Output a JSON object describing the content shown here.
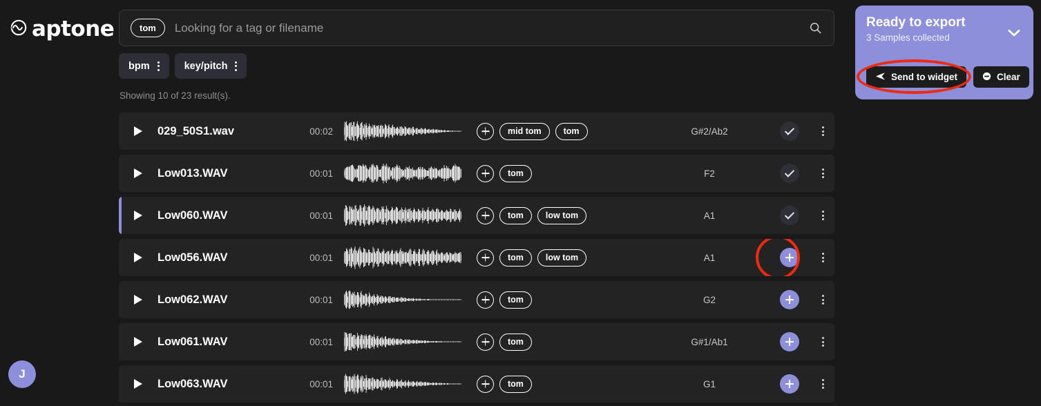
{
  "app": {
    "brand": "aptone",
    "logo_icon": "wave-circle-logo-icon",
    "avatar_initial": "J"
  },
  "search": {
    "chip_label": "tom",
    "placeholder": "Looking for a tag or filename",
    "value": "",
    "search_icon": "search-icon"
  },
  "filters": [
    {
      "label": "bpm",
      "menu_icon": "kebab-menu-icon"
    },
    {
      "label": "key/pitch",
      "menu_icon": "kebab-menu-icon"
    }
  ],
  "results_summary": "Showing 10 of 23 result(s).",
  "colors": {
    "accent_purple": "#8D8FDB",
    "page_bg": "#191919",
    "row_bg": "#232323",
    "annotation_red": "#F02A10",
    "chip_bg": "#2E2E36"
  },
  "rows": [
    {
      "filename": "029_50S1.wav",
      "duration": "00:02",
      "tags": [
        "mid tom",
        "tom"
      ],
      "key": "G#2/Ab2",
      "action_state": "added",
      "action_icon": "check-icon",
      "selected": false,
      "waveform": "decay-long"
    },
    {
      "filename": "Low013.WAV",
      "duration": "00:01",
      "tags": [
        "tom"
      ],
      "key": "F2",
      "action_state": "added",
      "action_icon": "check-icon",
      "selected": false,
      "waveform": "sustained-even"
    },
    {
      "filename": "Low060.WAV",
      "duration": "00:01",
      "tags": [
        "tom",
        "low tom"
      ],
      "key": "A1",
      "action_state": "added",
      "action_icon": "check-icon",
      "selected": true,
      "waveform": "dense-sustain"
    },
    {
      "filename": "Low056.WAV",
      "duration": "00:01",
      "tags": [
        "tom",
        "low tom"
      ],
      "key": "A1",
      "action_state": "addable",
      "action_icon": "plus-icon",
      "selected": false,
      "waveform": "dense-sustain",
      "annotated": true
    },
    {
      "filename": "Low062.WAV",
      "duration": "00:01",
      "tags": [
        "tom"
      ],
      "key": "G2",
      "action_state": "addable",
      "action_icon": "plus-icon",
      "selected": false,
      "waveform": "decay-fast"
    },
    {
      "filename": "Low061.WAV",
      "duration": "00:01",
      "tags": [
        "tom"
      ],
      "key": "G#1/Ab1",
      "action_state": "addable",
      "action_icon": "plus-icon",
      "selected": false,
      "waveform": "decay-med"
    },
    {
      "filename": "Low063.WAV",
      "duration": "00:01",
      "tags": [
        "tom"
      ],
      "key": "G1",
      "action_state": "addable",
      "action_icon": "plus-icon",
      "selected": false,
      "waveform": "decay-dense"
    }
  ],
  "export_panel": {
    "title": "Ready to export",
    "subtitle": "3 Samples collected",
    "collapse_icon": "chevron-down-icon",
    "send_label": "Send to widget",
    "send_icon": "send-icon",
    "clear_label": "Clear",
    "clear_icon": "minus-circle-icon"
  }
}
